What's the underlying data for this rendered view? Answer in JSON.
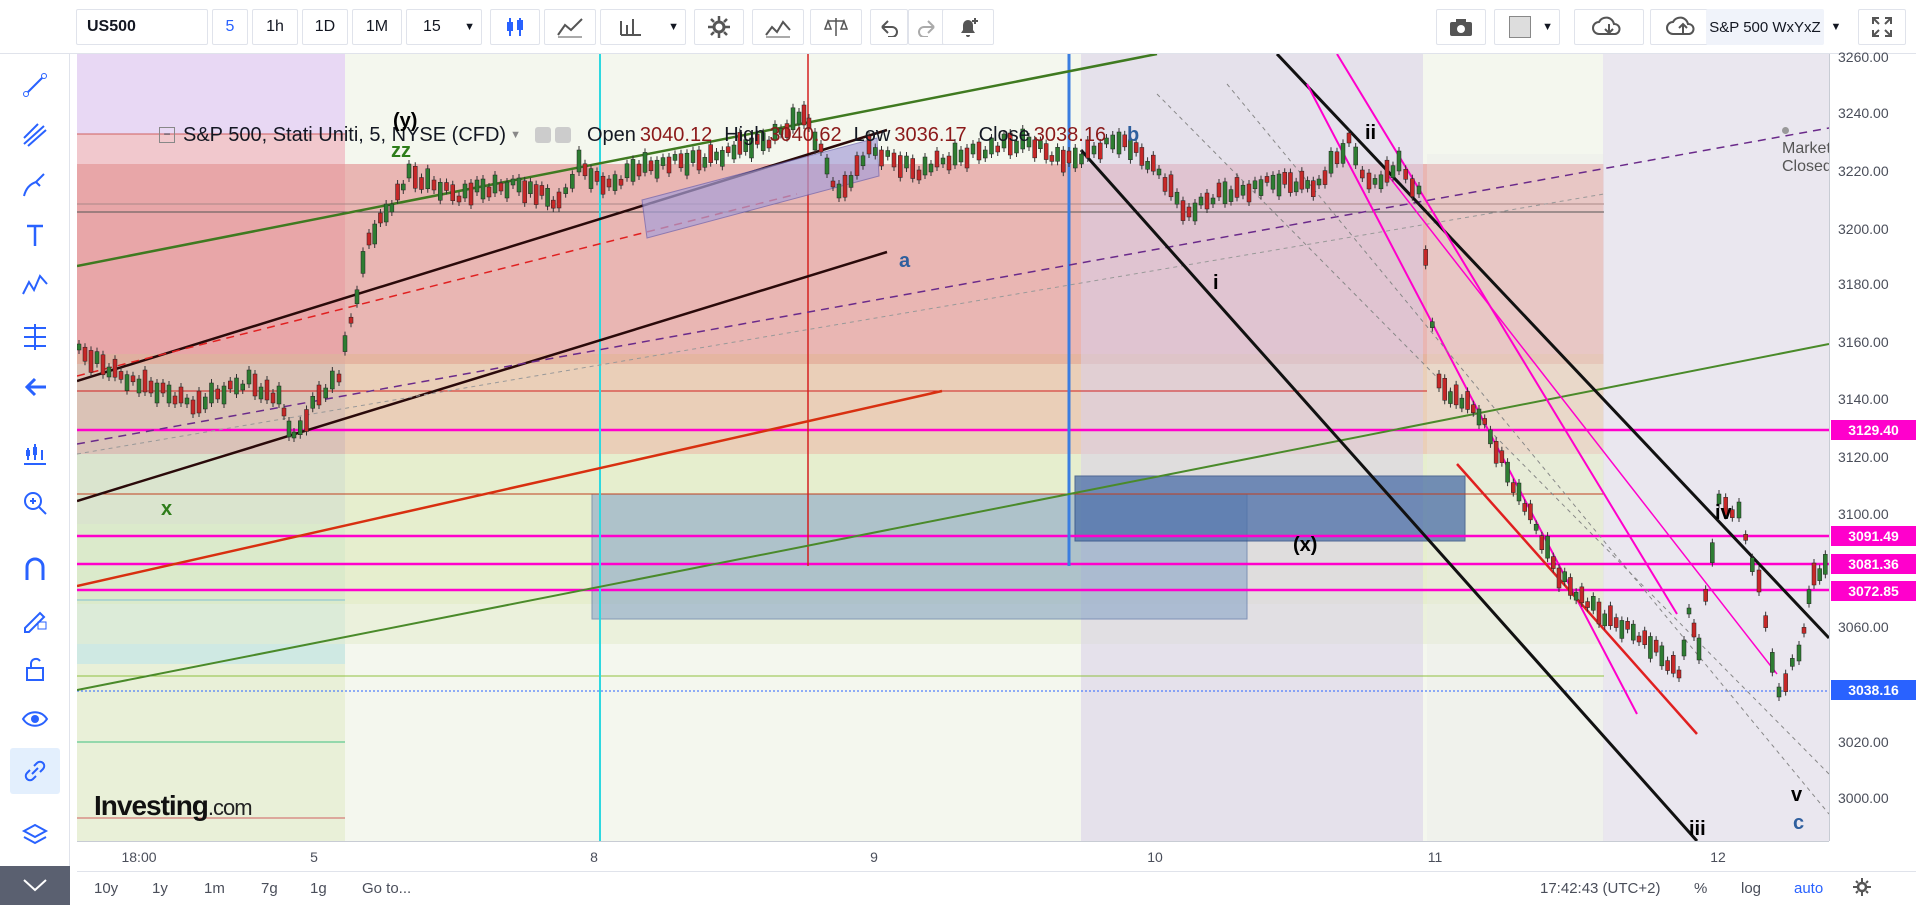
{
  "toolbar": {
    "symbol": "US500",
    "intervals": [
      "5",
      "1h",
      "1D",
      "1M"
    ],
    "interval_dropdown": "15",
    "symbol_right": "S&P 500 WxYxZ"
  },
  "legend": {
    "title": "S&P 500, Stati Uniti, 5, NYSE (CFD)",
    "open_label": "Open",
    "open": "3040.12",
    "high_label": "High",
    "high": "3040.62",
    "low_label": "Low",
    "low": "3036.17",
    "close_label": "Close",
    "close": "3038.16"
  },
  "market_status": "Market Closed",
  "watermark": {
    "main": "Investing",
    "suffix": ".com"
  },
  "wave_labels": [
    {
      "text": "(y)",
      "color": "#000000"
    },
    {
      "text": "zz",
      "color": "#2e7d1a"
    },
    {
      "text": "x",
      "color": "#2e7d1a"
    },
    {
      "text": "a",
      "color": "#2f5f9e"
    },
    {
      "text": "b",
      "color": "#2f5f9e"
    },
    {
      "text": "i",
      "color": "#000000"
    },
    {
      "text": "ii",
      "color": "#000000"
    },
    {
      "text": "iii",
      "color": "#000000"
    },
    {
      "text": "iv",
      "color": "#000000"
    },
    {
      "text": "v",
      "color": "#000000"
    },
    {
      "text": "c",
      "color": "#2f5f9e"
    },
    {
      "text": "(x)",
      "color": "#000000"
    }
  ],
  "price_scale": {
    "ticks": [
      "3260.00",
      "3240.00",
      "3220.00",
      "3200.00",
      "3180.00",
      "3160.00",
      "3140.00",
      "3120.00",
      "3100.00",
      "3060.00",
      "3020.00",
      "3000.00"
    ],
    "levels": [
      {
        "label": "3129.40",
        "color": "#ff00cc"
      },
      {
        "label": "3091.49",
        "color": "#ff00cc"
      },
      {
        "label": "3081.36",
        "color": "#ff00cc"
      },
      {
        "label": "3072.85",
        "color": "#ff00cc"
      },
      {
        "label": "3038.16",
        "color": "#2962ff"
      }
    ]
  },
  "time_scale": [
    "18:00",
    "5",
    "8",
    "9",
    "10",
    "11",
    "12"
  ],
  "bottom_bar": {
    "ranges": [
      "10y",
      "1y",
      "1m",
      "7g",
      "1g"
    ],
    "goto": "Go to...",
    "clock": "17:42:43 (UTC+2)",
    "percent": "%",
    "log": "log",
    "auto": "auto"
  },
  "colors": {
    "accent": "#2962ff",
    "magenta": "#ff00cc",
    "up": "#2e7d32",
    "down": "#c62828"
  }
}
